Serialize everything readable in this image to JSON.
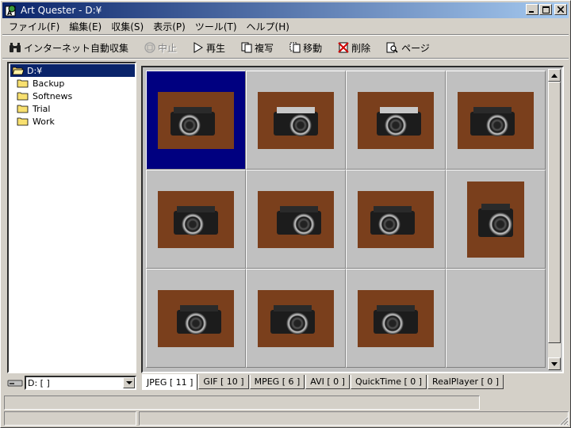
{
  "window": {
    "title": "Art Quester - D:¥"
  },
  "menu": [
    "ファイル(F)",
    "編集(E)",
    "収集(S)",
    "表示(P)",
    "ツール(T)",
    "ヘルプ(H)"
  ],
  "toolbar": {
    "internet_collect": "インターネット自動収集",
    "stop": "中止",
    "play": "再生",
    "copy": "複写",
    "move": "移動",
    "delete": "削除",
    "page": "ページ"
  },
  "tree": {
    "root": "D:¥",
    "folders": [
      "Backup",
      "Softnews",
      "Trial",
      "Work"
    ]
  },
  "drive_combo": {
    "value": "D: [  ]"
  },
  "tabs": [
    "JPEG [ 11 ]",
    "GIF [ 10 ]",
    "MPEG [ 6 ]",
    "AVI [ 0 ]",
    "QuickTime [ 0 ]",
    "RealPlayer [ 0 ]"
  ],
  "active_tab_index": 0,
  "thumbnails": {
    "count": 11,
    "selected_index": 0
  },
  "colors": {
    "title_start": "#0a246a",
    "title_end": "#a6caf0",
    "selection": "#000080",
    "photo_bg": "#7a3f1c"
  }
}
